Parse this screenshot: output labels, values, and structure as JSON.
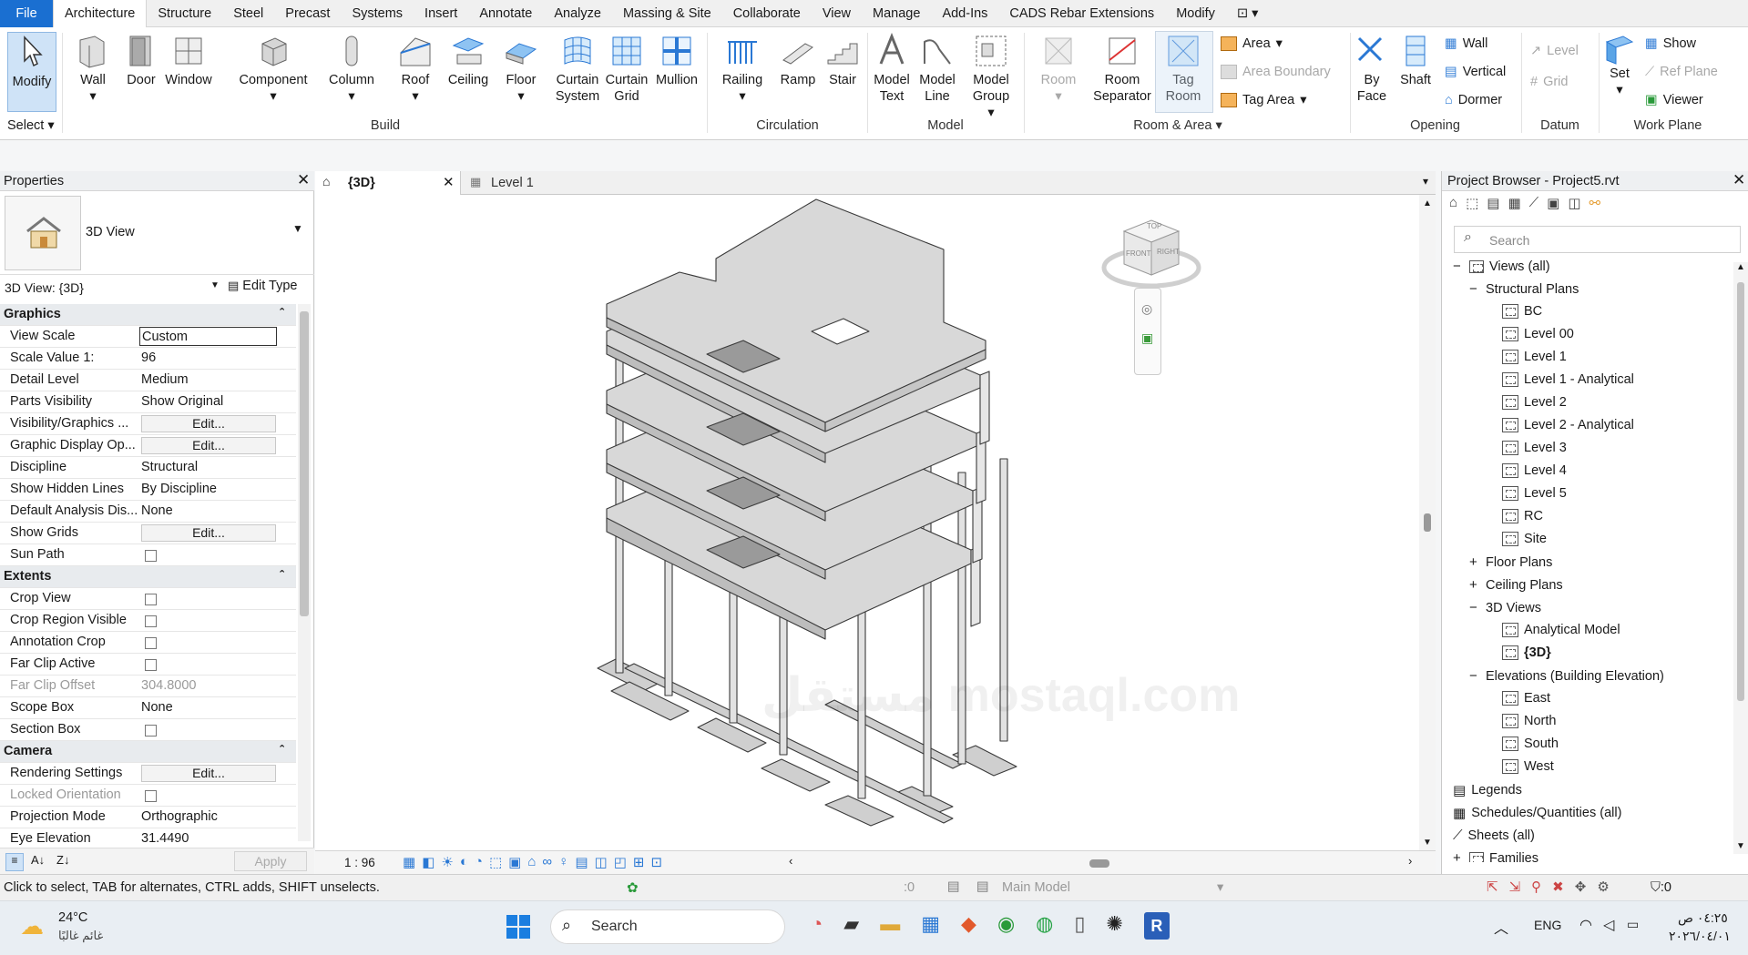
{
  "menu_tabs": [
    "File",
    "Architecture",
    "Structure",
    "Steel",
    "Precast",
    "Systems",
    "Insert",
    "Annotate",
    "Analyze",
    "Massing & Site",
    "Collaborate",
    "View",
    "Manage",
    "Add-Ins",
    "CADS Rebar Extensions",
    "Modify"
  ],
  "ribbon": {
    "modify": "Modify",
    "select": "Select",
    "build": [
      "Wall",
      "Door",
      "Window",
      "Component",
      "Column",
      "Roof",
      "Ceiling",
      "Floor",
      "Curtain System",
      "Curtain Grid",
      "Mullion"
    ],
    "build_label": "Build",
    "circulation": [
      "Railing",
      "Ramp",
      "Stair"
    ],
    "circulation_label": "Circulation",
    "model": [
      "Model Text",
      "Model Line",
      "Model Group"
    ],
    "model_label": "Model",
    "room": [
      "Room",
      "Room Separator",
      "Tag Room"
    ],
    "room_small": [
      "Area",
      "Area  Boundary",
      "Tag  Area"
    ],
    "room_label": "Room & Area",
    "opening_big": [
      "By Face",
      "Shaft"
    ],
    "opening_small": [
      "Wall",
      "Vertical",
      "Dormer"
    ],
    "opening_label": "Opening",
    "datum_small": [
      "Level",
      "Grid"
    ],
    "datum_label": "Datum",
    "workplane_big": "Set",
    "workplane_small": [
      "Show",
      "Ref  Plane",
      "Viewer"
    ],
    "workplane_label": "Work Plane"
  },
  "properties": {
    "title": "Properties",
    "type_name": "3D View",
    "view_selector": "3D View: {3D}",
    "edit_type": "Edit Type",
    "apply": "Apply",
    "rows": [
      {
        "cat": "Graphics"
      },
      {
        "k": "View Scale",
        "v": "Custom",
        "box": true
      },
      {
        "k": "Scale Value    1:",
        "v": "96"
      },
      {
        "k": "Detail Level",
        "v": "Medium"
      },
      {
        "k": "Parts Visibility",
        "v": "Show Original"
      },
      {
        "k": "Visibility/Graphics ...",
        "btn": "Edit..."
      },
      {
        "k": "Graphic Display Op...",
        "btn": "Edit..."
      },
      {
        "k": "Discipline",
        "v": "Structural"
      },
      {
        "k": "Show Hidden Lines",
        "v": "By Discipline"
      },
      {
        "k": "Default Analysis Dis...",
        "v": "None"
      },
      {
        "k": "Show Grids",
        "btn": "Edit..."
      },
      {
        "k": "Sun Path",
        "cb": true
      },
      {
        "cat": "Extents"
      },
      {
        "k": "Crop View",
        "cb": true
      },
      {
        "k": "Crop Region Visible",
        "cb": true
      },
      {
        "k": "Annotation Crop",
        "cb": true
      },
      {
        "k": "Far Clip Active",
        "cb": true
      },
      {
        "k": "Far Clip Offset",
        "v": "304.8000",
        "dim": true
      },
      {
        "k": "Scope Box",
        "v": "None"
      },
      {
        "k": "Section Box",
        "cb": true
      },
      {
        "cat": "Camera"
      },
      {
        "k": "Rendering Settings",
        "btn": "Edit..."
      },
      {
        "k": "Locked Orientation",
        "cb": true,
        "dim": true
      },
      {
        "k": "Projection Mode",
        "v": "Orthographic"
      },
      {
        "k": "Eye Elevation",
        "v": "31.4490"
      }
    ]
  },
  "view_tabs": [
    "{3D}",
    "Level 1"
  ],
  "view_scale": "1 : 96",
  "viewcube": {
    "top": "TOP",
    "front": "FRONT",
    "right": "RIGHT"
  },
  "project_browser": {
    "title": "Project Browser - Project5.rvt",
    "search_placeholder": "Search",
    "items": [
      {
        "lvl": 0,
        "t": "Views (all)",
        "exp": "−"
      },
      {
        "lvl": 1,
        "t": "Structural Plans",
        "exp": "−"
      },
      {
        "lvl": 2,
        "t": "BC"
      },
      {
        "lvl": 2,
        "t": "Level 00"
      },
      {
        "lvl": 2,
        "t": "Level 1"
      },
      {
        "lvl": 2,
        "t": "Level 1 - Analytical"
      },
      {
        "lvl": 2,
        "t": "Level 2"
      },
      {
        "lvl": 2,
        "t": "Level 2 - Analytical"
      },
      {
        "lvl": 2,
        "t": "Level 3"
      },
      {
        "lvl": 2,
        "t": "Level 4"
      },
      {
        "lvl": 2,
        "t": "Level 5"
      },
      {
        "lvl": 2,
        "t": "RC"
      },
      {
        "lvl": 2,
        "t": "Site"
      },
      {
        "lvl": 1,
        "t": "Floor Plans",
        "exp": "+"
      },
      {
        "lvl": 1,
        "t": "Ceiling Plans",
        "exp": "+"
      },
      {
        "lvl": 1,
        "t": "3D Views",
        "exp": "−"
      },
      {
        "lvl": 2,
        "t": "Analytical Model"
      },
      {
        "lvl": 2,
        "t": "{3D}",
        "bold": true
      },
      {
        "lvl": 1,
        "t": "Elevations (Building Elevation)",
        "exp": "−"
      },
      {
        "lvl": 2,
        "t": "East"
      },
      {
        "lvl": 2,
        "t": "North"
      },
      {
        "lvl": 2,
        "t": "South"
      },
      {
        "lvl": 2,
        "t": "West"
      },
      {
        "lvl": 0,
        "t": "Legends",
        "ico": "legend"
      },
      {
        "lvl": 0,
        "t": "Schedules/Quantities (all)",
        "ico": "sched"
      },
      {
        "lvl": 0,
        "t": "Sheets (all)",
        "ico": "sheet"
      },
      {
        "lvl": 0,
        "t": "Families",
        "exp": "+"
      }
    ]
  },
  "status": {
    "hint": "Click to select, TAB for alternates, CTRL adds, SHIFT unselects.",
    "sel_count": ":0",
    "model": "Main Model",
    "filter_count": ":0"
  },
  "taskbar": {
    "temp": "24°C",
    "weather": "غائم غالبًا",
    "search": "Search",
    "lang": "ENG",
    "time": "٠٤:٢٥ ص",
    "date": "٢٠٢٦/٠٤/٠١"
  },
  "watermark": "مستقل mostaql.com",
  "colors": {
    "file_tab": "#1a6fd1",
    "accent": "#2a78d4",
    "slab": "#d9d9d9"
  }
}
